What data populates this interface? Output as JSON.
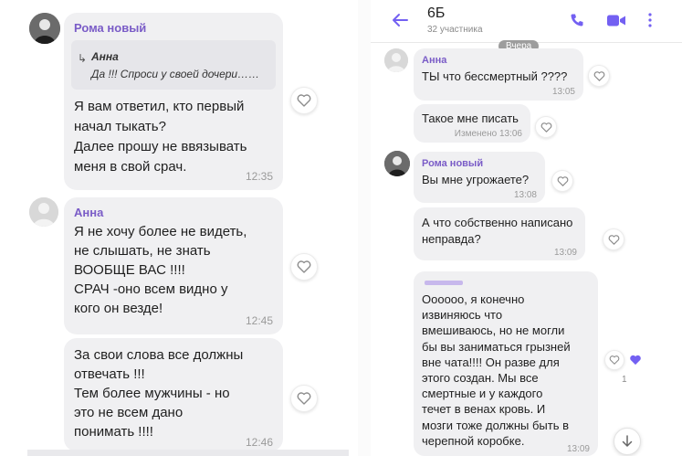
{
  "left": {
    "messages": [
      {
        "sender": "Рома новый",
        "quote": {
          "author": "Анна",
          "text": "Да !!! Спроси у своей дочери……"
        },
        "text": "Я вам ответил, кто первый\nначал тыкать?\nДалее прошу не ввязывать\nменя в свой срач.",
        "time": "12:35"
      },
      {
        "sender": "Анна",
        "text": "Я не хочу более не видеть,\nне слышать, не знать\nВООБЩЕ ВАС !!!!\nСРАЧ -оно всем видно у\nкого он везде!",
        "time": "12:45"
      },
      {
        "sender": "",
        "text": "За свои слова все должны\nотвечать !!!\nТем более мужчины - но\nэто не всем дано\nпонимать !!!!",
        "time": "12:46"
      }
    ]
  },
  "right": {
    "header": {
      "title": "6Б",
      "subtitle": "32 участника",
      "icons": [
        "back-arrow-icon",
        "phone-icon",
        "video-call-icon",
        "more-icon"
      ]
    },
    "date_divider": "Вчера",
    "messages": [
      {
        "sender": "Анна",
        "text": "ТЫ что бессмертный ????",
        "time": "13:05"
      },
      {
        "sender": "",
        "text": "Такое мне писать",
        "edited": "Изменено",
        "time": "13:06"
      },
      {
        "sender": "Рома новый",
        "text": "Вы мне угрожаете?",
        "time": "13:08"
      },
      {
        "sender": "",
        "text": "А что собственно написано\nнеправда?",
        "time": "13:09"
      },
      {
        "sender": "",
        "text": "Оооооо, я конечно\nизвиняюсь что\nвмешиваюсь, но не могли\nбы вы заниматься грызней\nвне чата!!!! Он разве для\nэтого создан. Мы все\nсмертные и у каждого\nтечет в венах кровь. И\nмозги тоже должны быть в\nчерепной коробке.",
        "time": "13:09",
        "likes": "1"
      }
    ]
  },
  "colors": {
    "accent": "#7360f2",
    "sender_name": "#7a5cc7",
    "bubble": "#f0f0f2",
    "time": "#9a9a9a"
  }
}
